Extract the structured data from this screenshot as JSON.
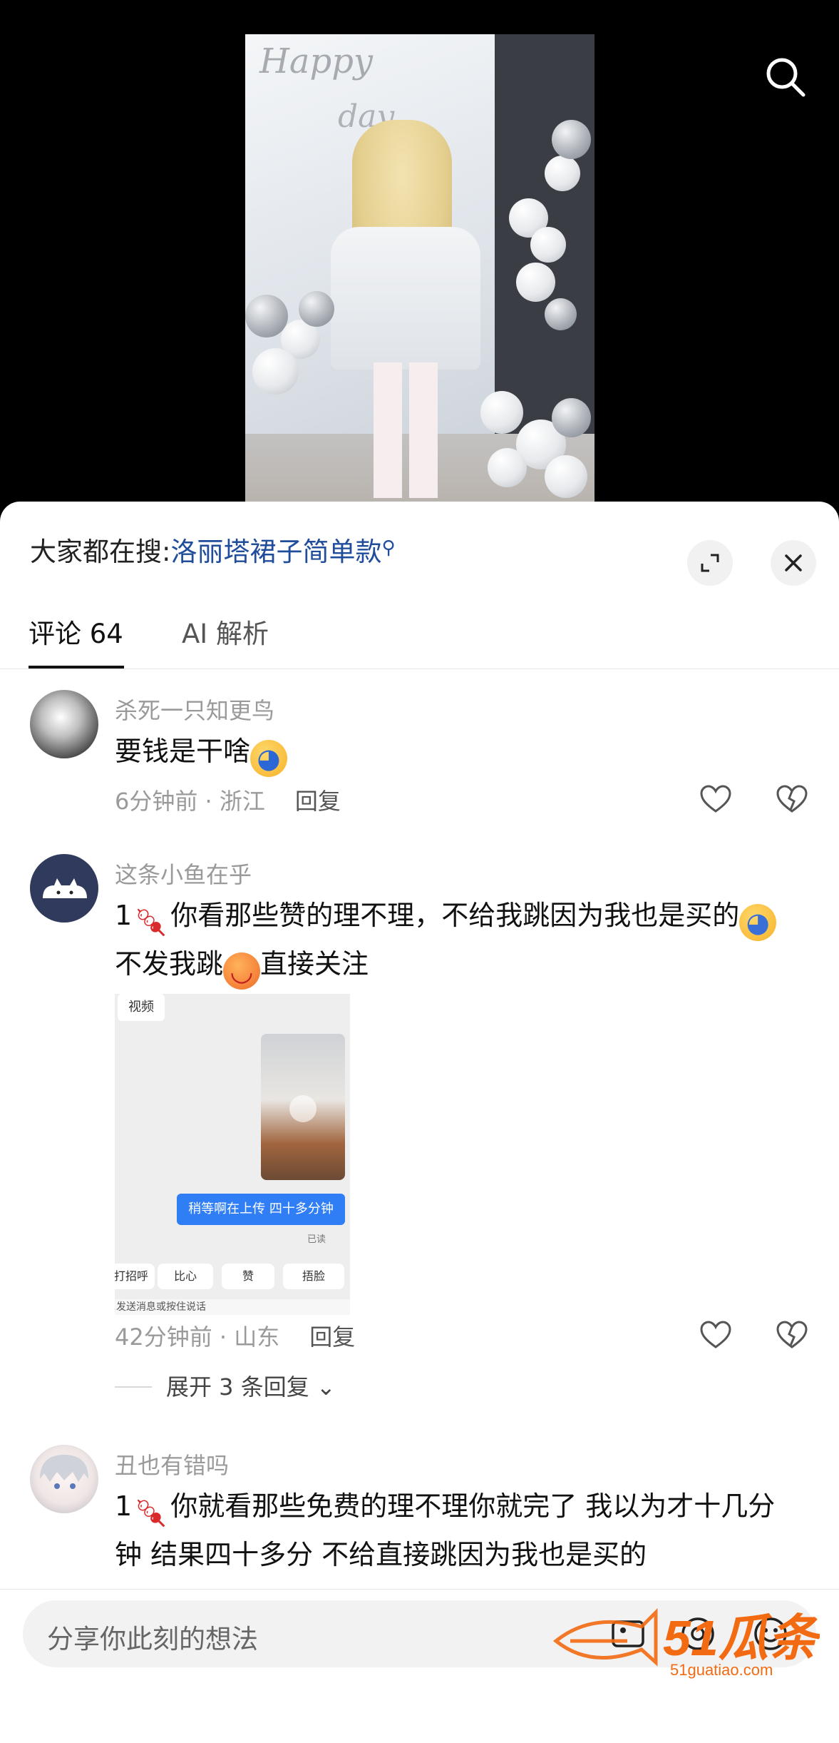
{
  "hot_search": {
    "prefix": "大家都在搜:",
    "query": "洛丽塔裙子简单款"
  },
  "video": {
    "overlay_text_1": "Happy",
    "overlay_text_2": "day"
  },
  "tabs": [
    {
      "label": "评论 64",
      "active": true
    },
    {
      "label": "AI 解析",
      "active": false
    }
  ],
  "comments": [
    {
      "username": "杀死一只知更鸟",
      "text_before_emoji": "要钱是干啥",
      "time_location": "6分钟前 · 浙江",
      "reply_label": "回复"
    },
    {
      "username": "这条小鱼在乎",
      "line1_prefix": "1",
      "line1_text": "你看那些赞的理不理，不给我跳因为我也是买的",
      "line2_text_a": "不发我跳",
      "line2_text_b": "直接关注",
      "image": {
        "label": "视频",
        "bubble_text": "稍等啊在上传 四十多分钟",
        "read_status": "已读",
        "quick_replies": [
          "打招呼",
          "比心",
          "赞",
          "捂脸"
        ],
        "bottom_text": "发送消息或按住说话"
      },
      "time_location": "42分钟前 · 山东",
      "reply_label": "回复",
      "expand_label": "展开 3 条回复"
    },
    {
      "username": "丑也有错吗",
      "line1_prefix": "1",
      "line1_text": "你就看那些免费的理不理你就完了 我以为才十几分",
      "line2_text": "钟 结果四十多分 不给直接跳因为我也是买的"
    }
  ],
  "input": {
    "placeholder": "分享你此刻的想法"
  },
  "watermark": {
    "brand": "51瓜条",
    "url": "51guatiao.com"
  },
  "colors": {
    "link_blue": "#1f4d9b",
    "meta_gray": "#9a9a9a",
    "watermark_orange": "#f26a12"
  }
}
